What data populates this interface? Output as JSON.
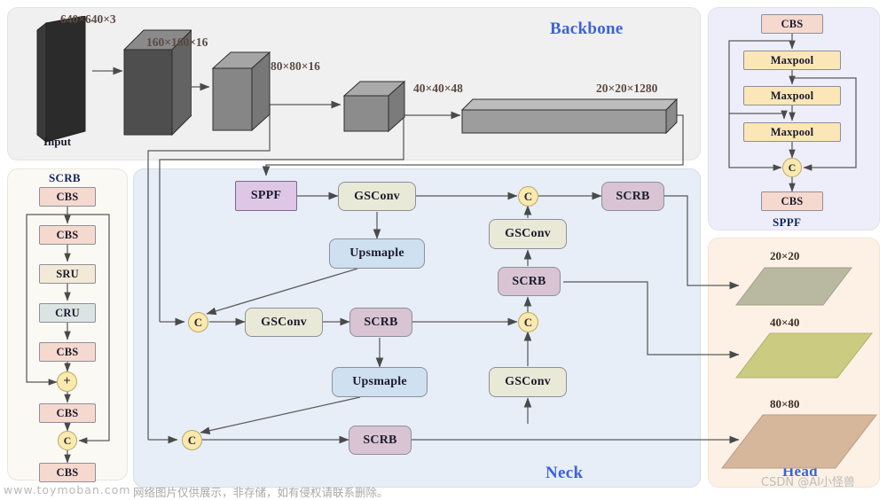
{
  "panels": {
    "backbone": {
      "title": "Backbone"
    },
    "neck": {
      "title": "Neck"
    },
    "head": {
      "title": "Head"
    },
    "sppf": {
      "title": "SPPF"
    },
    "scrb": {
      "title": "SCRB"
    }
  },
  "backbone": {
    "input_label": "Input",
    "stages": [
      {
        "dim": "640×640×3"
      },
      {
        "dim": "160×160×16"
      },
      {
        "dim": "80×80×16"
      },
      {
        "dim": "40×40×48"
      },
      {
        "dim": "20×20×1280"
      }
    ]
  },
  "neck": {
    "nodes": {
      "sppf": "SPPF",
      "gsconv_top": "GSConv",
      "upsample_top": "Upsmaple",
      "concat_p4": "C",
      "gsconv_mid": "GSConv",
      "scrb_p4": "SCRB",
      "upsample_bot": "Upsmaple",
      "concat_p3": "C",
      "scrb_p3": "SCRB",
      "gsconv_up1": "GSConv",
      "concat_d1": "C",
      "scrb_d1": "SCRB",
      "gsconv_up2": "GSConv",
      "concat_d2": "C",
      "scrb_d2": "SCRB"
    }
  },
  "head": {
    "outputs": [
      {
        "dim": "20×20"
      },
      {
        "dim": "40×40"
      },
      {
        "dim": "80×80"
      }
    ]
  },
  "sppf_module": {
    "blocks": [
      "CBS",
      "Maxpool",
      "Maxpool",
      "Maxpool",
      "C",
      "CBS"
    ]
  },
  "scrb_module": {
    "blocks": [
      "CBS",
      "CBS",
      "SRU",
      "CRU",
      "CBS",
      "+",
      "CBS",
      "C",
      "CBS"
    ]
  },
  "watermarks": {
    "left": "www.toymoban.com",
    "center": "网络图片仅供展示，非存储，如有侵权请联系删除。",
    "csdn": "CSDN @AI小怪兽"
  },
  "colors": {
    "cbs": "#f6d9ce",
    "maxpool": "#fbe6b8",
    "sru": "#f2e9d6",
    "cru": "#dbe4e2",
    "sppf": "#ddc6e6",
    "gsconv": "#e9e9d7",
    "upsample": "#cfe0f0",
    "scrb": "#d8c4d2",
    "concat": "#fbe9ad",
    "accent": "#3a63d8",
    "head20": "#b9b9a2",
    "head40": "#cbcb82",
    "head80": "#d6b79b"
  }
}
